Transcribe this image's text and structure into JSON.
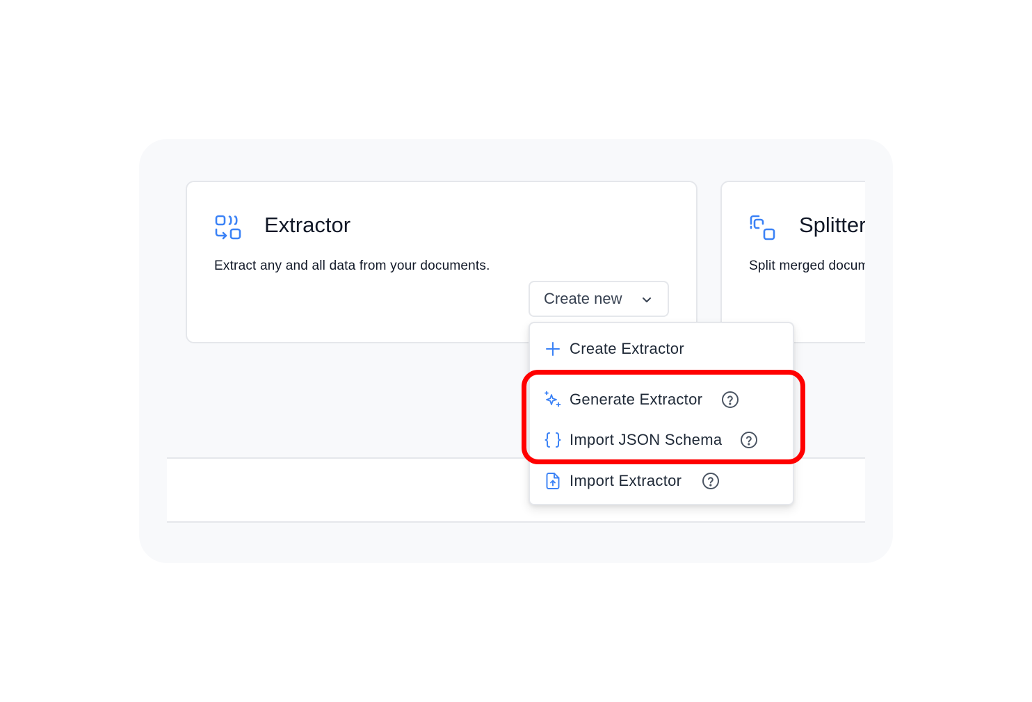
{
  "cards": {
    "extractor": {
      "title": "Extractor",
      "description": "Extract any and all data from your documents.",
      "icon": "extractor-icon"
    },
    "splitter": {
      "title": "Splitter",
      "description": "Split merged documents",
      "icon": "splitter-icon"
    }
  },
  "create_button": {
    "label": "Create new",
    "icon": "chevron-down-icon"
  },
  "menu": {
    "items": [
      {
        "label": "Create Extractor",
        "icon": "plus-icon",
        "help": false
      },
      {
        "label": "Generate Extractor",
        "icon": "sparkles-icon",
        "help": true
      },
      {
        "label": "Import JSON Schema",
        "icon": "braces-icon",
        "help": true
      },
      {
        "label": "Import Extractor",
        "icon": "file-upload-icon",
        "help": true
      }
    ]
  },
  "colors": {
    "accent": "#3b82f6",
    "highlight": "#ff0000",
    "panel_bg": "#f8f9fb",
    "border": "#e5e7eb"
  }
}
